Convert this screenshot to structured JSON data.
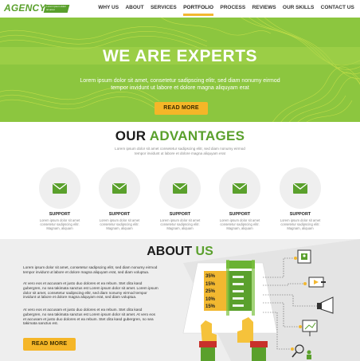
{
  "brand": {
    "name": "AGENCY",
    "tagline": "Lorem ipsum dolor sit amet",
    "accent": "#5aa02c",
    "hero_green": "#8cc63f",
    "button_yellow": "#f5b628"
  },
  "nav": {
    "items": [
      {
        "label": "WHY US",
        "active": false
      },
      {
        "label": "ABOUT",
        "active": false
      },
      {
        "label": "SERVICES",
        "active": false
      },
      {
        "label": "PORTFOLIO",
        "active": true
      },
      {
        "label": "PROCESS",
        "active": false
      },
      {
        "label": "REVIEWS",
        "active": false
      },
      {
        "label": "OUR SKILLS",
        "active": false
      },
      {
        "label": "CONTACT US",
        "active": false
      }
    ]
  },
  "hero": {
    "title": "WE ARE EXPERTS",
    "subtitle": "Lorem ipsum dolor sit amet, consetetur sadipscing elitr, sed diam nonumy eirmod tempor invidunt ut labore et dolore magna aliquyam erat",
    "button_label": "READ MORE"
  },
  "advantages": {
    "title_main": "OUR ",
    "title_highlight": "ADVANTAGES",
    "description": "Lorem ipsum dolor sit amet consetetur sadipscing elitr, sed diam nonumy eirmod tempor invidunt ut labore et dolore magna aliquyam erat",
    "features": [
      {
        "icon": "envelope-icon",
        "label": "SUPPORT",
        "text": "Lorem ipsum dolor sit amet consetetur sadipscing elitr. Magnam, aliquam"
      },
      {
        "icon": "envelope-icon",
        "label": "SUPPORT",
        "text": "Lorem ipsum dolor sit amet consetetur sadipscing elitr. Magnam, aliquam"
      },
      {
        "icon": "envelope-icon",
        "label": "SUPPORT",
        "text": "Lorem ipsum dolor sit amet consetetur sadipscing elitr. Magnam, aliquam"
      },
      {
        "icon": "envelope-icon",
        "label": "SUPPORT",
        "text": "Lorem ipsum dolor sit amet consetetur sadipscing elitr. Magnam, aliquam"
      },
      {
        "icon": "envelope-icon",
        "label": "SUPPORT",
        "text": "Lorem ipsum dolor sit amet consetetur sadipscing elitr. Magnam, aliquam"
      }
    ]
  },
  "about": {
    "title_main": "ABOUT ",
    "title_highlight": "US",
    "paragraphs": [
      "Lorem ipsum dolor sit amet, consetetur sadipscing elitr, sed diam nonumy eirmod tempor invidunt ut labore et dolore magna aliquyam erat, sed diam voluptua.",
      "At vero eos et accusam et justo duo dolores et ea rebum. Stet clita kasd gubergren, no sea takimata sanctus est Lorem ipsum dolor sit amet. Lorem ipsum dolor sit amet, consetetur sadipscing elitr, sed diam nonumy eirmod tempor invidunt ut labore et dolore magna aliquyam erat, sed diam voluptua.",
      "At vero eos et accusam et justo duo dolores et ea rebum. Stet clita kasd gubergren, no sea takimata sanctus est Lorem ipsum dolor sit amet. At vero eos et accusam et justo duo dolores et ea rebum. Stet clita kasd gubergren, no sea takimata sanctus est."
    ],
    "button_label": "READ MORE",
    "stats": [
      {
        "label": "35%",
        "value": 0.35
      },
      {
        "label": "15%",
        "value": 0.15
      },
      {
        "label": "25%",
        "value": 0.25
      },
      {
        "label": "10%",
        "value": 0.1
      },
      {
        "label": "15%",
        "value": 0.15
      }
    ],
    "side_icons": [
      "user-card-icon",
      "video-icon",
      "megaphone-icon",
      "chart-board-icon",
      "people-search-icon"
    ]
  }
}
